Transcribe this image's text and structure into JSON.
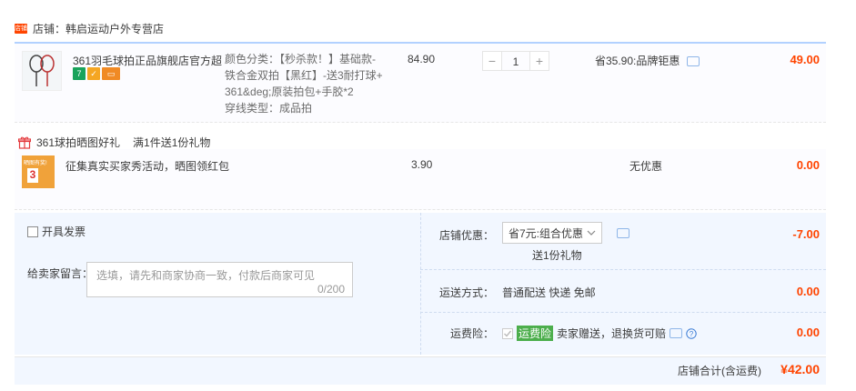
{
  "shop": {
    "icon_label": "店铺",
    "label": "店铺：韩启运动户外专营店"
  },
  "item": {
    "title": "361羽毛球拍正品旗舰店官方超...",
    "sku_lines": [
      "颜色分类：【秒杀款！】基础款-",
      "铁合金双拍【黑红】-送3耐打球+",
      "361&deg;原装拍包+手胶*2",
      "穿线类型：成品拍"
    ],
    "unit_price": "84.90",
    "quantity": "1",
    "minus": "−",
    "plus": "+",
    "promo": "省35.90:品牌钜惠",
    "subtotal": "49.00",
    "badges": [
      "7",
      "✓",
      "▭"
    ]
  },
  "gift": {
    "header": "361球拍晒图好礼",
    "rule": "满1件送1份礼物",
    "thumb_text": "晒图有奖!",
    "thumb_num": "3",
    "title": "征集真实买家秀活动，晒图领红包",
    "price": "3.90",
    "promo": "无优惠",
    "subtotal": "0.00"
  },
  "panel": {
    "invoice_label": "开具发票",
    "message_label": "给卖家留言：",
    "message_placeholder": "选填，请先和商家协商一致，付款后商家可见",
    "message_counter": "0/200",
    "shop_discount_label": "店铺优惠：",
    "shop_discount_value": "省7元:组合优惠",
    "shop_discount_sub": "送1份礼物",
    "shop_discount_amount": "-7.00",
    "shipping_label": "运送方式：",
    "shipping_value": "普通配送 快递 免邮",
    "shipping_amount": "0.00",
    "insurance_label": "运费险：",
    "insurance_tag": "运费险",
    "insurance_text": "卖家赠送，退换货可赔",
    "insurance_amount": "0.00"
  },
  "total": {
    "label": "店铺合计(含运费)",
    "amount": "¥42.00"
  },
  "colors": {
    "accent": "#f40",
    "border_blue": "#b2d1ff",
    "panel_bg": "#f2f7ff"
  }
}
